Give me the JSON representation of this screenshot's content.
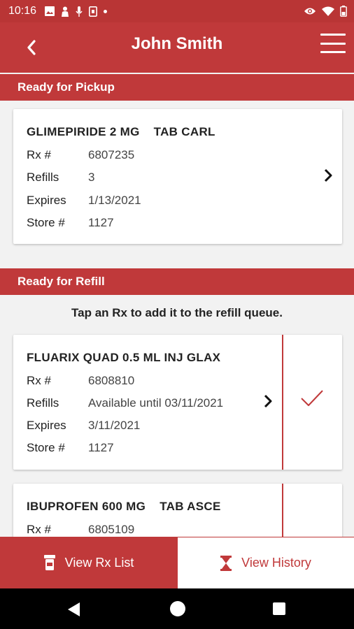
{
  "status": {
    "time": "10:16"
  },
  "header": {
    "title": "John Smith"
  },
  "pickup": {
    "section_title": "Ready for Pickup",
    "items": [
      {
        "name": "GLIMEPIRIDE 2 MG    TAB CARL",
        "rx_label": "Rx #",
        "rx": "6807235",
        "refills_label": "Refills",
        "refills": "3",
        "expires_label": "Expires",
        "expires": "1/13/2021",
        "store_label": "Store #",
        "store": "1127"
      }
    ]
  },
  "refill": {
    "section_title": "Ready for Refill",
    "hint": "Tap an Rx to add it to the refill queue.",
    "items": [
      {
        "name": "FLUARIX QUAD 0.5 ML INJ GLAX",
        "rx_label": "Rx #",
        "rx": "6808810",
        "refills_label": "Refills",
        "refills": "Available until 03/11/2021",
        "expires_label": "Expires",
        "expires": "3/11/2021",
        "store_label": "Store #",
        "store": "1127",
        "selected": true
      },
      {
        "name": "IBUPROFEN 600 MG    TAB ASCE",
        "rx_label": "Rx #",
        "rx": "6805109"
      }
    ]
  },
  "bottom": {
    "rx_list_label": "View Rx List",
    "history_label": "View History"
  },
  "colors": {
    "accent": "#c0393a",
    "statusbar": "#b93535"
  }
}
